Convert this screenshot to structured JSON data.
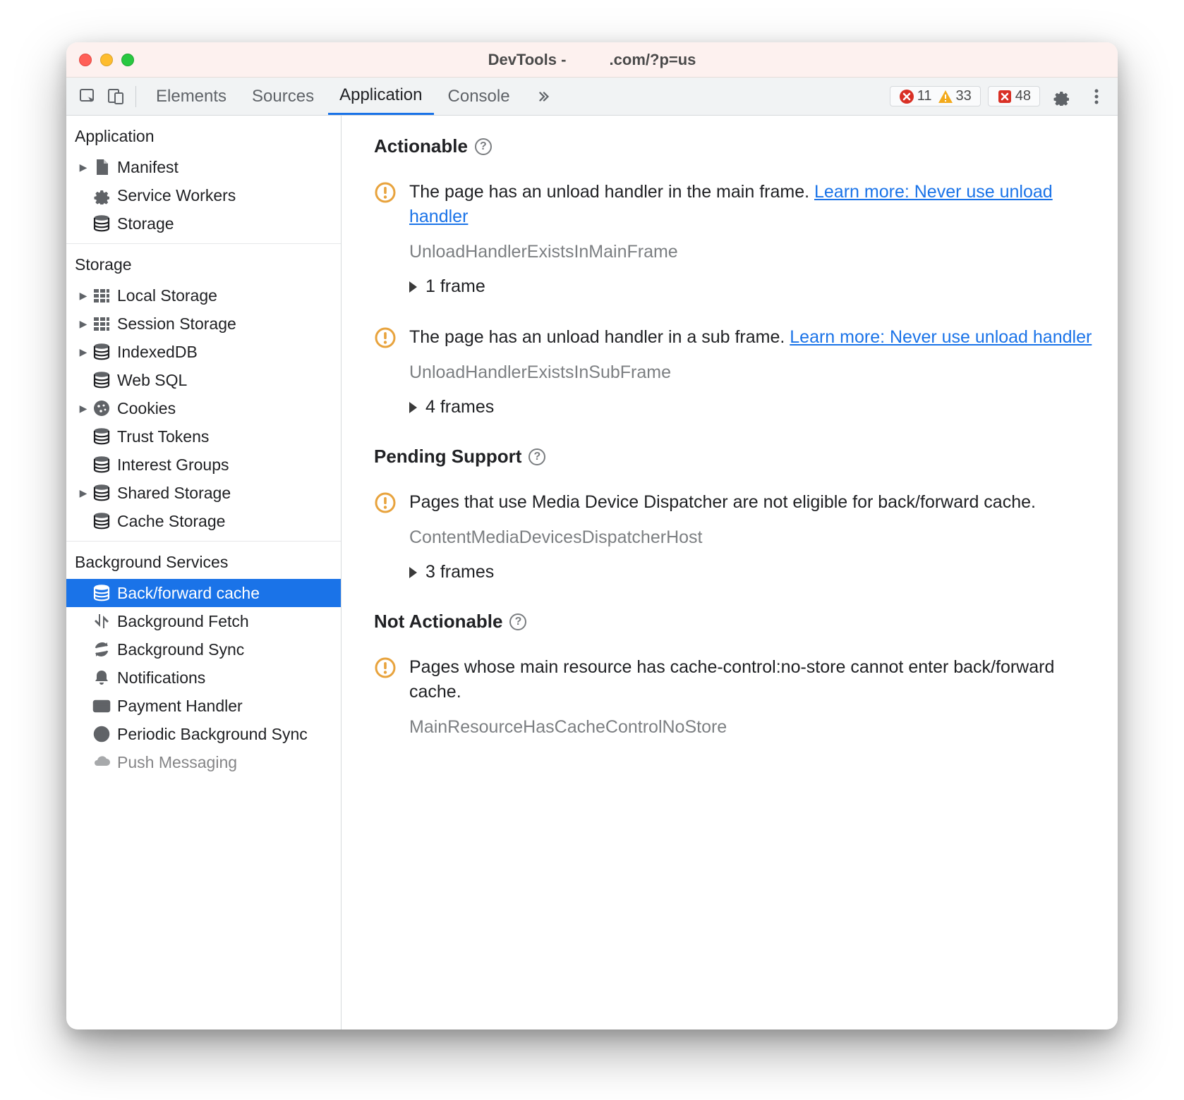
{
  "window": {
    "title_prefix": "DevTools - ",
    "title_suffix": ".com/?p=us"
  },
  "toolbar": {
    "tabs": {
      "elements": "Elements",
      "sources": "Sources",
      "application": "Application",
      "console": "Console"
    },
    "errors_count": "11",
    "warnings_count": "33",
    "issues_count": "48"
  },
  "sidebar": {
    "application": {
      "title": "Application",
      "items": {
        "manifest": "Manifest",
        "service_workers": "Service Workers",
        "storage": "Storage"
      }
    },
    "storage": {
      "title": "Storage",
      "items": {
        "local": "Local Storage",
        "session": "Session Storage",
        "indexeddb": "IndexedDB",
        "websql": "Web SQL",
        "cookies": "Cookies",
        "trust": "Trust Tokens",
        "interest": "Interest Groups",
        "shared": "Shared Storage",
        "cache": "Cache Storage"
      }
    },
    "background": {
      "title": "Background Services",
      "items": {
        "bfcache": "Back/forward cache",
        "bgfetch": "Background Fetch",
        "bgsync": "Background Sync",
        "notifications": "Notifications",
        "payment": "Payment Handler",
        "periodic": "Periodic Background Sync",
        "push": "Push Messaging"
      }
    }
  },
  "main": {
    "sections": {
      "actionable": "Actionable",
      "pending": "Pending Support",
      "notactionable": "Not Actionable"
    },
    "learn_more": "Learn more: Never use unload handler",
    "issues": {
      "a1": {
        "text": "The page has an unload handler in the main frame. ",
        "code": "UnloadHandlerExistsInMainFrame",
        "frames": "1 frame"
      },
      "a2": {
        "text": "The page has an unload handler in a sub frame. ",
        "code": "UnloadHandlerExistsInSubFrame",
        "frames": "4 frames"
      },
      "p1": {
        "text": "Pages that use Media Device Dispatcher are not eligible for back/forward cache.",
        "code": "ContentMediaDevicesDispatcherHost",
        "frames": "3 frames"
      },
      "n1": {
        "text": "Pages whose main resource has cache-control:no-store cannot enter back/forward cache.",
        "code": "MainResourceHasCacheControlNoStore"
      }
    }
  }
}
